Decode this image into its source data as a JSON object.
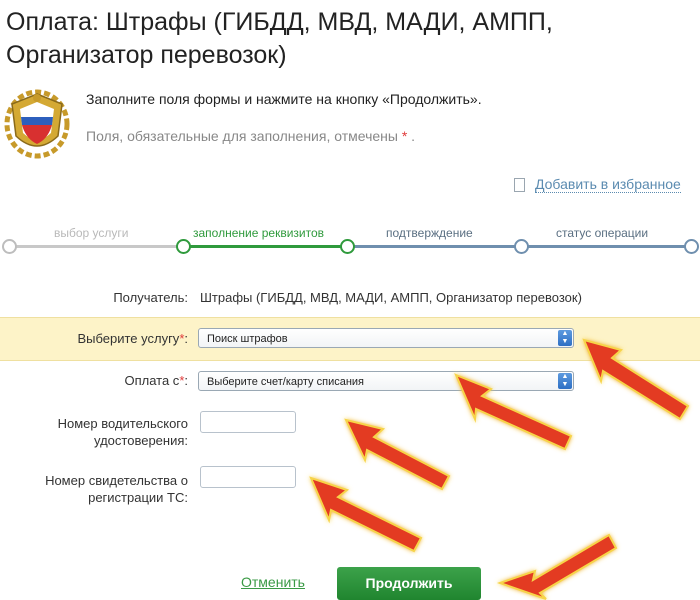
{
  "page": {
    "title": "Оплата: Штрафы (ГИБДД, МВД, МАДИ, АМПП, Организатор перевозок)"
  },
  "info": {
    "line1": "Заполните поля формы и нажмите на кнопку «Продолжить».",
    "line2": "Поля, обязательные для заполнения, отмечены",
    "required_mark": "*",
    "line2_end": "."
  },
  "favorites": {
    "label": "Добавить в избранное",
    "icon": "bookmark-icon"
  },
  "steps": [
    {
      "label": "выбор услуги",
      "state": "done"
    },
    {
      "label": "заполнение реквизитов",
      "state": "active"
    },
    {
      "label": "подтверждение",
      "state": "todo"
    },
    {
      "label": "статус операции",
      "state": "todo"
    }
  ],
  "form": {
    "recipient_label": "Получатель:",
    "recipient_value": "Штрафы (ГИБДД, МВД, МАДИ, АМПП, Организатор перевозок)",
    "service_label": "Выберите услугу",
    "service_value": "Поиск штрафов",
    "pay_from_label": "Оплата с",
    "pay_from_value": "Выберите счет/карту списания",
    "license_label_1": "Номер водительского",
    "license_label_2": "удостоверения:",
    "license_value": "",
    "registration_label_1": "Номер свидетельства о",
    "registration_label_2": "регистрации ТС:",
    "registration_value": "",
    "required_mark": "*",
    "colon": ":"
  },
  "actions": {
    "cancel_label": "Отменить",
    "continue_label": "Продолжить"
  },
  "colors": {
    "accent_green": "#2f9a3c",
    "done_gray": "#c8c8c8",
    "todo_blue": "#6f8fae",
    "highlight": "#fdf3c8",
    "arrow_red": "#e33a22"
  }
}
